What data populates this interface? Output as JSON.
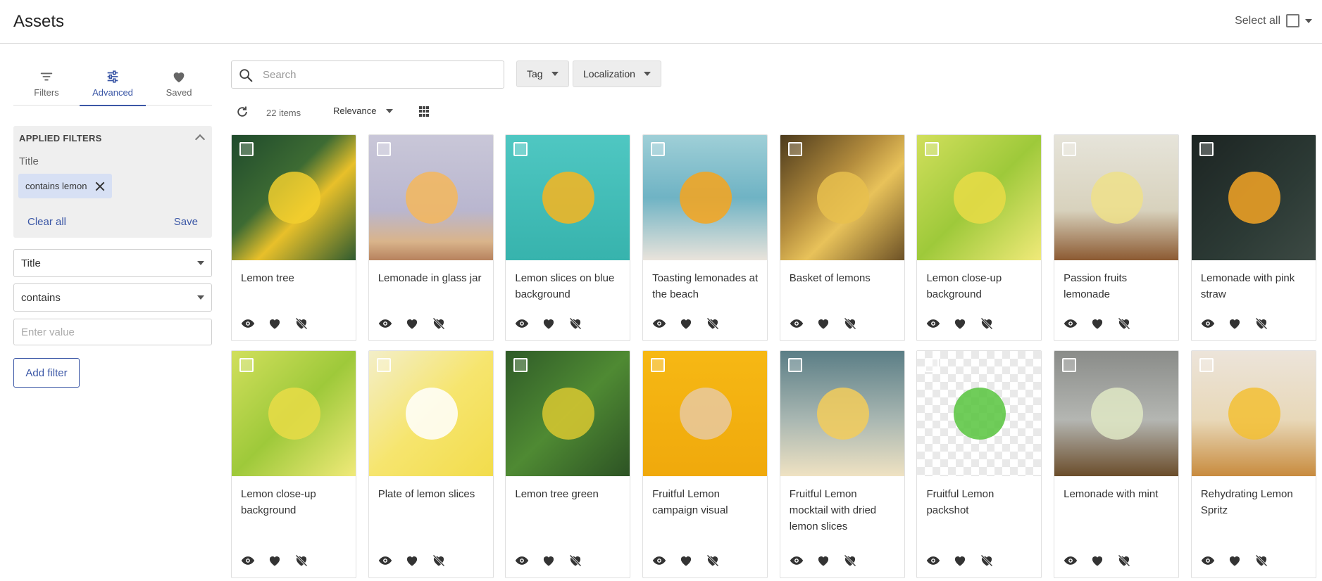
{
  "header": {
    "title": "Assets",
    "select_all_label": "Select all"
  },
  "sidebar": {
    "tabs": [
      {
        "label": "Filters",
        "icon": "filter-lines-icon"
      },
      {
        "label": "Advanced",
        "icon": "sliders-icon",
        "active": true
      },
      {
        "label": "Saved",
        "icon": "heart-icon"
      }
    ],
    "applied": {
      "heading": "APPLIED FILTERS",
      "field_label": "Title",
      "chip": "contains lemon",
      "clear_label": "Clear all",
      "save_label": "Save"
    },
    "field_select": "Title",
    "operator_select": "contains",
    "value_placeholder": "Enter value",
    "add_filter_label": "Add filter"
  },
  "toolbar": {
    "search_placeholder": "Search",
    "tag_label": "Tag",
    "localization_label": "Localization",
    "item_count": "22 items",
    "sort_label": "Relevance"
  },
  "colors": {
    "accent": "#3b57a6",
    "chip_bg": "#d7e0f4"
  },
  "assets": [
    {
      "name": "Lemon tree",
      "bg": "linear-gradient(135deg,#1f4a2c,#3d6b33 40%,#e8c02a 60%,#2d5a30)",
      "dot": "#f2cf2e"
    },
    {
      "name": "Lemonade in glass jar",
      "bg": "linear-gradient(180deg,#c9c7d8,#b9b6cf 60%,#d9b48b 85%,#b7825e)",
      "dot": "#f4b75c"
    },
    {
      "name": "Lemon slices on blue background",
      "bg": "linear-gradient(180deg,#4fc7c2,#37b3ad)",
      "dot": "#f8b51f"
    },
    {
      "name": "Toasting lemonades at the beach",
      "bg": "linear-gradient(180deg,#9fcfd7,#6fb3c4 50%,#e9e3db)",
      "dot": "#f7a51c"
    },
    {
      "name": "Basket of lemons",
      "bg": "linear-gradient(135deg,#4c3a1c,#b38c3d 40%,#e8c25a 60%,#6b5026)",
      "dot": "#e7c04e"
    },
    {
      "name": "Lemon close-up background",
      "bg": "linear-gradient(135deg,#d1df5c,#9ec93a 50%,#f1ea7a)",
      "dot": "#e9dc46"
    },
    {
      "name": "Passion fruits lemonade",
      "bg": "linear-gradient(180deg,#e6e4da,#d8d2bd 60%,#8c5a32)",
      "dot": "#efe08a"
    },
    {
      "name": "Lemonade with pink straw",
      "bg": "linear-gradient(135deg,#1c2422,#2c3a35 60%,#3d4a44)",
      "dot": "#f5a524"
    },
    {
      "name": "Lemon close-up background",
      "bg": "linear-gradient(135deg,#d1df5c,#9ec93a 50%,#f1ea7a)",
      "dot": "#e9dc46"
    },
    {
      "name": "Plate of lemon slices",
      "bg": "linear-gradient(135deg,#f3eec9,#f6e56e 50%,#f2dc4b)",
      "dot": "#ffffff"
    },
    {
      "name": "Lemon tree green",
      "bg": "linear-gradient(135deg,#2f5b28,#4f8a33 50%,#2c5224)",
      "dot": "#d9c830"
    },
    {
      "name": "Fruitful Lemon campaign visual",
      "bg": "linear-gradient(180deg,#f6b814,#f0a90c)",
      "dot": "#e8c9a0"
    },
    {
      "name": "Fruitful Lemon mocktail with dried lemon slices",
      "bg": "linear-gradient(180deg,#5b7e86,#a9b7b2 55%,#efe2c2)",
      "dot": "#f3cd5b"
    },
    {
      "name": "Fruitful Lemon packshot",
      "bg": "repeating-conic-gradient(#e9e9e9 0% 25%, #ffffff 0% 50%) 0 0/22px 22px",
      "dot": "#57c43d"
    },
    {
      "name": "Lemonade with mint",
      "bg": "linear-gradient(180deg,#8a8c89,#b4b6b2 55%,#6b4d2b)",
      "dot": "#dfe7c4"
    },
    {
      "name": "Rehydrating Lemon Spritz",
      "bg": "linear-gradient(180deg,#ece4da,#e8d8b8 55%,#c88b3e)",
      "dot": "#f3c034"
    }
  ]
}
